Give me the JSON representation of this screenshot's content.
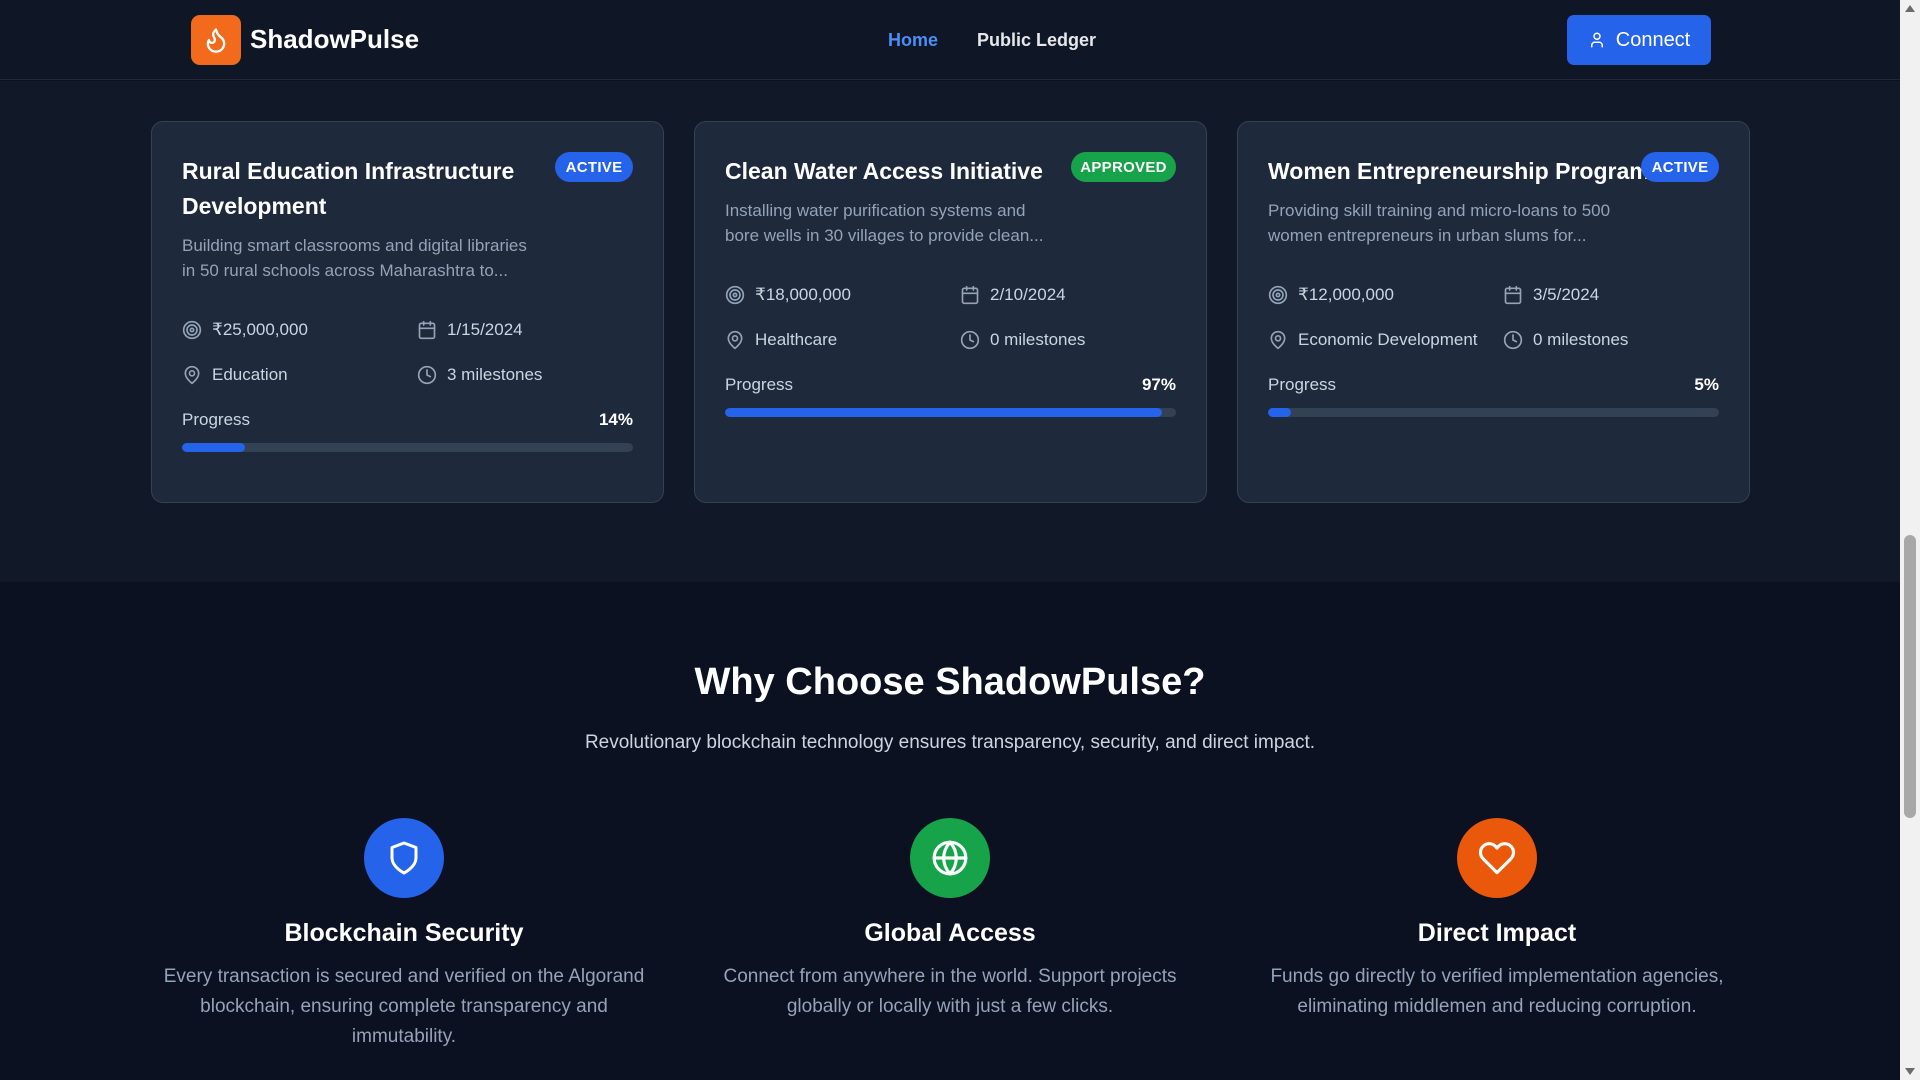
{
  "header": {
    "brand": "ShadowPulse",
    "nav": {
      "home": "Home",
      "ledger": "Public Ledger"
    },
    "connect_label": "Connect"
  },
  "colors": {
    "accent": "#2563eb",
    "brand_orange": "#f26a1b",
    "badge_active": "#2563eb",
    "badge_approved": "#16a34a",
    "feature_blue": "#2563eb",
    "feature_green": "#16a34a",
    "feature_orange": "#ea580c"
  },
  "projects": [
    {
      "title_line1": "Rural Education Infrastructure",
      "title_line2": "Development",
      "badge": "ACTIVE",
      "desc_line1": "Building smart classrooms and digital libraries",
      "desc_line2": "in 50 rural schools across Maharashtra to...",
      "amount": "₹25,000,000",
      "date": "1/15/2024",
      "category": "Education",
      "milestones": "3 milestones",
      "progress_label": "Progress",
      "progress_text": "14%",
      "progress": 0.14
    },
    {
      "title_line1": "Clean Water Access Initiative",
      "title_line2": "",
      "badge": "APPROVED",
      "desc_line1": "Installing water purification systems and",
      "desc_line2": "bore wells in 30 villages to provide clean...",
      "amount": "₹18,000,000",
      "date": "2/10/2024",
      "category": "Healthcare",
      "milestones": "0 milestones",
      "progress_label": "Progress",
      "progress_text": "97%",
      "progress": 0.97
    },
    {
      "title_line1": "Women Entrepreneurship Program",
      "title_line2": "",
      "badge": "ACTIVE",
      "desc_line1": "Providing skill training and micro-loans to 500",
      "desc_line2": "women entrepreneurs in urban slums for...",
      "amount": "₹12,000,000",
      "date": "3/5/2024",
      "category": "Economic Development",
      "milestones": "0 milestones",
      "progress_label": "Progress",
      "progress_text": "5%",
      "progress": 0.05
    }
  ],
  "why": {
    "title": "Why Choose ShadowPulse?",
    "subtitle": "Revolutionary blockchain technology ensures transparency, security, and direct impact.",
    "features": [
      {
        "icon": "shield-icon",
        "title": "Blockchain Security",
        "line1": "Every transaction is secured and verified on the Algorand",
        "line2": "blockchain, ensuring complete transparency and",
        "line3": "immutability."
      },
      {
        "icon": "globe-icon",
        "title": "Global Access",
        "line1": "Connect from anywhere in the world. Support projects",
        "line2": "globally or locally with just a few clicks.",
        "line3": ""
      },
      {
        "icon": "heart-icon",
        "title": "Direct Impact",
        "line1": "Funds go directly to verified implementation agencies,",
        "line2": "eliminating middlemen and reducing corruption.",
        "line3": ""
      }
    ]
  }
}
